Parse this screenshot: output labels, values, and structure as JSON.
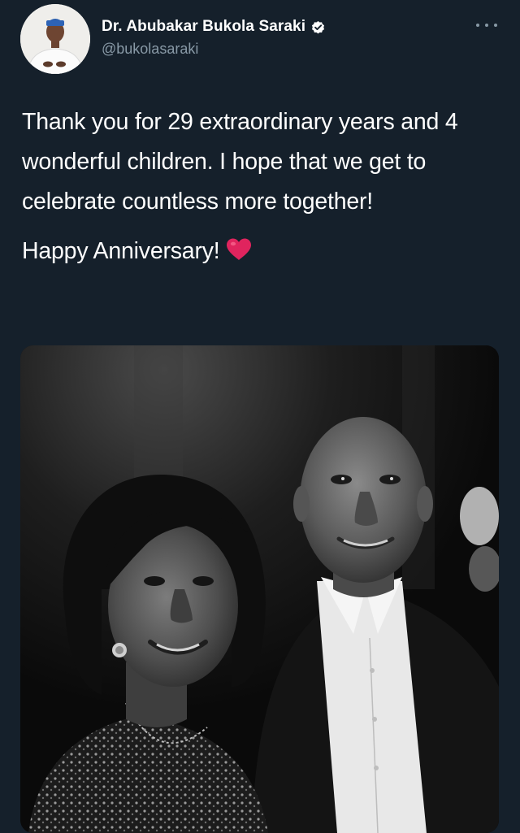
{
  "author": {
    "display_name": "Dr. Abubakar Bukola Saraki",
    "handle": "@bukolasaraki",
    "verified": true
  },
  "tweet": {
    "paragraphs": [
      "Thank you for 29 extraordinary years and 4 wonderful children. I hope that we get to celebrate countless more together!",
      "Happy Anniversary!"
    ],
    "emoji": "heart-icon"
  },
  "media": {
    "type": "photo",
    "tone": "black-and-white"
  },
  "colors": {
    "background": "#15202b",
    "text_primary": "#ffffff",
    "text_secondary": "#8899a6",
    "verified_badge": "#ffffff",
    "heart": "#e0245e"
  }
}
